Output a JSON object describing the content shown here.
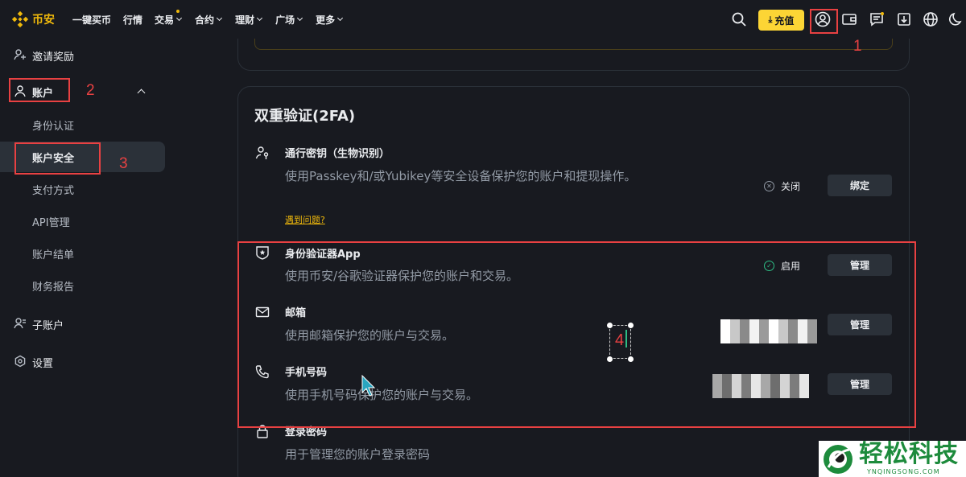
{
  "brand": {
    "name": "币安",
    "accent": "#f0b90b"
  },
  "nav": [
    {
      "label": "一键买币",
      "dropdown": false,
      "badge": false
    },
    {
      "label": "行情",
      "dropdown": false,
      "badge": false
    },
    {
      "label": "交易",
      "dropdown": true,
      "badge": true
    },
    {
      "label": "合约",
      "dropdown": true,
      "badge": false
    },
    {
      "label": "理财",
      "dropdown": true,
      "badge": false
    },
    {
      "label": "广场",
      "dropdown": true,
      "badge": false
    },
    {
      "label": "更多",
      "dropdown": true,
      "badge": false
    }
  ],
  "toolbar": {
    "deposit_label": "充值",
    "icons": [
      "search-icon",
      "download-arrow-icon",
      "user-profile-icon",
      "wallet-icon",
      "message-icon",
      "download-app-icon",
      "globe-icon",
      "moon-icon"
    ]
  },
  "sidebar": {
    "items": [
      {
        "label": "邀请奖励",
        "icon": "invite-user-icon"
      },
      {
        "label": "账户",
        "icon": "user-icon",
        "expanded": true
      },
      {
        "label": "子账户",
        "icon": "sub-account-icon"
      },
      {
        "label": "设置",
        "icon": "settings-icon"
      }
    ],
    "subitems": [
      {
        "label": "身份认证",
        "active": false
      },
      {
        "label": "账户安全",
        "active": true
      },
      {
        "label": "支付方式",
        "active": false
      },
      {
        "label": "API管理",
        "active": false
      },
      {
        "label": "账户结单",
        "active": false
      },
      {
        "label": "财务报告",
        "active": false
      }
    ]
  },
  "twofa": {
    "title": "双重验证(2FA)",
    "rows": [
      {
        "title": "通行密钥（生物识别）",
        "desc": "使用Passkey和/或Yubikey等安全设备保护您的账户和提现操作。",
        "link": "遇到问题?",
        "status": "关闭",
        "button": "绑定",
        "icon": "passkey-icon"
      },
      {
        "title": "身份验证器App",
        "desc": "使用币安/谷歌验证器保护您的账户和交易。",
        "status": "启用",
        "button": "管理",
        "icon": "authenticator-shield-icon"
      },
      {
        "title": "邮箱",
        "desc": "使用邮箱保护您的账户与交易。",
        "button": "管理",
        "icon": "envelope-icon"
      },
      {
        "title": "手机号码",
        "desc": "使用手机号码保护您的账户与交易。",
        "button": "管理",
        "icon": "phone-icon"
      },
      {
        "title": "登录密码",
        "desc": "用于管理您的账户登录密码",
        "icon": "lock-icon"
      }
    ]
  },
  "annotations": {
    "n1": "1",
    "n2": "2",
    "n3": "3",
    "n4": "4",
    "color": "#e84142"
  },
  "watermark": {
    "text": "轻松科技",
    "sub": "YNQINGSONG.COM"
  }
}
